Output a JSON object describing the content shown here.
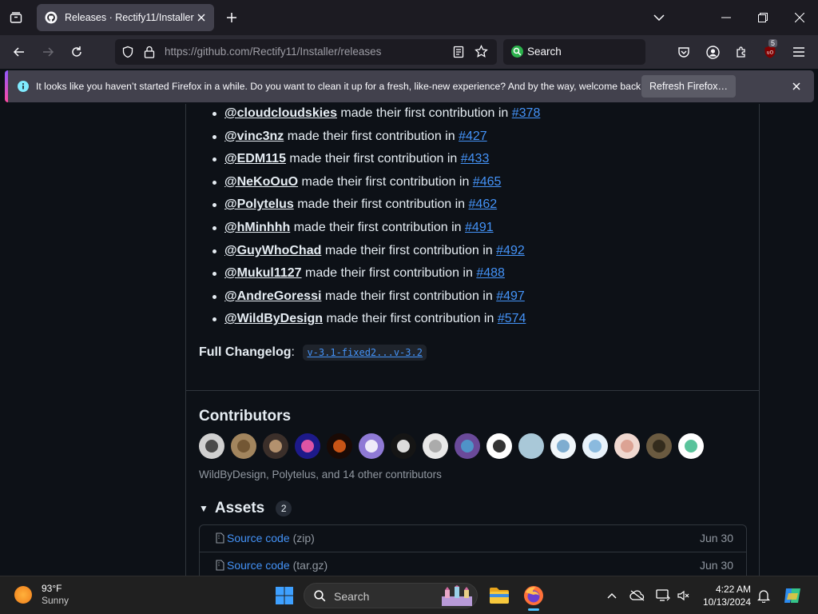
{
  "browser": {
    "tab_title": "Releases · Rectify11/Installer",
    "url_domain": "https://github.com",
    "url_path": "/Rectify11/Installer/releases",
    "search_placeholder": "Search",
    "addon_badge": "5",
    "notification": {
      "message": "It looks like you haven’t started Firefox in a while. Do you want to clean it up for a fresh, like-new experience? And by the way, welcome back!",
      "button_label": "Refresh Firefox…"
    }
  },
  "release": {
    "new_contributors": [
      {
        "user": "@cloudcloudskies",
        "text": "made their first contribution in",
        "pr": "#378"
      },
      {
        "user": "@vinc3nz",
        "text": "made their first contribution in",
        "pr": "#427"
      },
      {
        "user": "@EDM115",
        "text": "made their first contribution in",
        "pr": "#433"
      },
      {
        "user": "@NeKoOuO",
        "text": "made their first contribution in",
        "pr": "#465"
      },
      {
        "user": "@Polytelus",
        "text": "made their first contribution in",
        "pr": "#462"
      },
      {
        "user": "@hMinhhh",
        "text": "made their first contribution in",
        "pr": "#491"
      },
      {
        "user": "@GuyWhoChad",
        "text": "made their first contribution in",
        "pr": "#492"
      },
      {
        "user": "@Mukul1127",
        "text": "made their first contribution in",
        "pr": "#488"
      },
      {
        "user": "@AndreGoressi",
        "text": "made their first contribution in",
        "pr": "#497"
      },
      {
        "user": "@WildByDesign",
        "text": "made their first contribution in",
        "pr": "#574"
      }
    ],
    "changelog_label": "Full Changelog",
    "changelog_link": "v-3.1-fixed2...v-3.2",
    "contributors_heading": "Contributors",
    "contributor_avatars": [
      {
        "name": "lock-avatar",
        "color": "#d0d0d0",
        "fg": "#333333"
      },
      {
        "name": "dog-avatar",
        "color": "#a2855e",
        "fg": "#6b4f2d"
      },
      {
        "name": "bowl-avatar",
        "color": "#3b2f2a",
        "fg": "#c9a27a"
      },
      {
        "name": "pink-gem-avatar",
        "color": "#1d1a8a",
        "fg": "#ff5fa8"
      },
      {
        "name": "fire-avatar",
        "color": "#1a0a05",
        "fg": "#e8621a"
      },
      {
        "name": "purple-pattern-avatar",
        "color": "#8f7ad6",
        "fg": "#ffffff"
      },
      {
        "name": "edm-avatar",
        "color": "#151515",
        "fg": "#ffffff"
      },
      {
        "name": "default-person-avatar",
        "color": "#e8e8e8",
        "fg": "#a0a0a0"
      },
      {
        "name": "mosaic-avatar",
        "color": "#6a4a9a",
        "fg": "#4aa0d0"
      },
      {
        "name": "penguin-avatar",
        "color": "#ffffff",
        "fg": "#111111"
      },
      {
        "name": "light-blue-avatar",
        "color": "#a9c8d8",
        "fg": "#a9c8d8"
      },
      {
        "name": "sketch-avatar",
        "color": "#f0f6fa",
        "fg": "#6aa0c8"
      },
      {
        "name": "anime-avatar",
        "color": "#e8f2fa",
        "fg": "#7ab0d8"
      },
      {
        "name": "pink-character-avatar",
        "color": "#f0d8d0",
        "fg": "#d89a8a"
      },
      {
        "name": "face-photo-avatar",
        "color": "#6a5a40",
        "fg": "#2a2418"
      },
      {
        "name": "green-tile-avatar",
        "color": "#ffffff",
        "fg": "#3cb88a"
      }
    ],
    "contributors_summary": "WildByDesign, Polytelus, and 14 other contributors",
    "assets_heading": "Assets",
    "assets_count": "2",
    "assets": [
      {
        "name": "Source code",
        "ext": "(zip)",
        "date": "Jun 30"
      },
      {
        "name": "Source code",
        "ext": "(tar.gz)",
        "date": "Jun 30"
      }
    ]
  },
  "taskbar": {
    "temperature": "93°F",
    "condition": "Sunny",
    "search_label": "Search",
    "time": "4:22 AM",
    "date": "10/13/2024"
  }
}
